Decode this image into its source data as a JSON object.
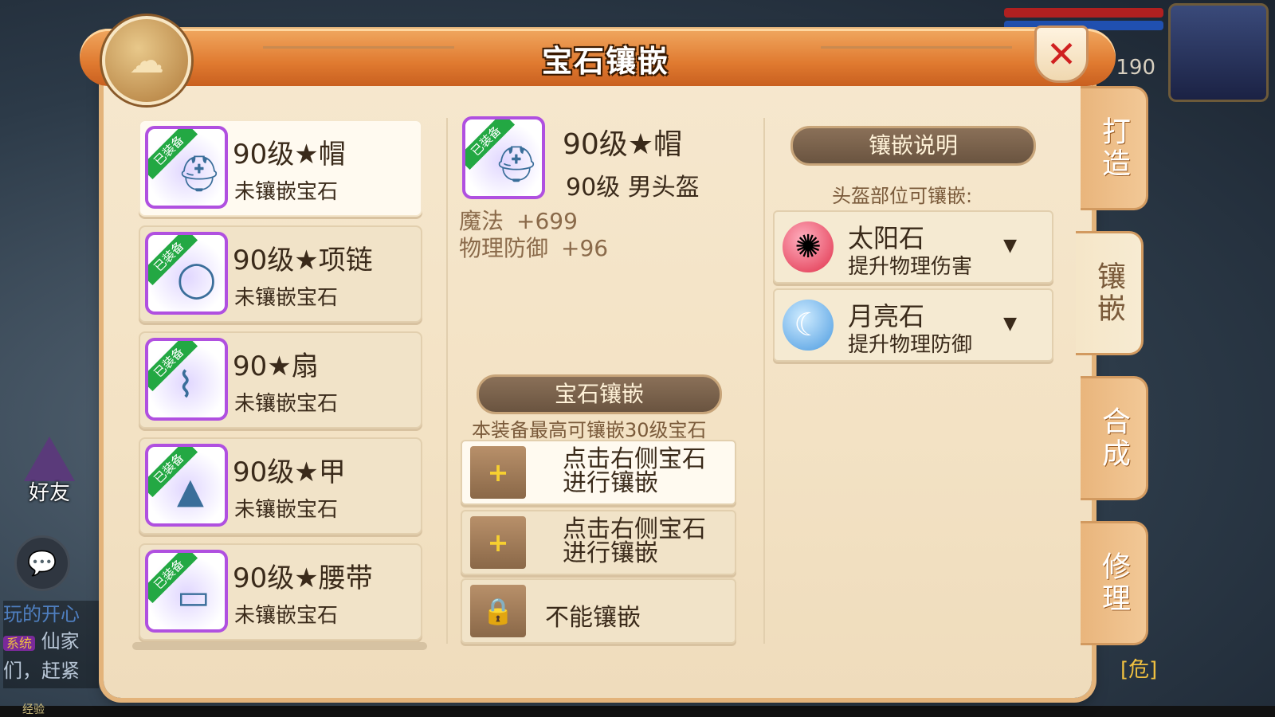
{
  "dialog": {
    "title": "宝石镶嵌",
    "close_icon": "✕"
  },
  "hud": {
    "level": "190"
  },
  "left_ui": {
    "friend_label": "好友",
    "chat_lines": [
      "玩的开心",
      "仙家",
      "们，赶紧"
    ],
    "chat_tag": "系统",
    "exp_label": "经验",
    "right_text": "[危]"
  },
  "side_tabs": [
    "打造",
    "镶嵌",
    "合成",
    "修理"
  ],
  "equipment": {
    "badge": "已装备",
    "items": [
      {
        "name": "90级★帽",
        "status": "未镶嵌宝石",
        "glyph": "⛑"
      },
      {
        "name": "90级★项链",
        "status": "未镶嵌宝石",
        "glyph": "◯"
      },
      {
        "name": "90★扇",
        "status": "未镶嵌宝石",
        "glyph": "⌇"
      },
      {
        "name": "90级★甲",
        "status": "未镶嵌宝石",
        "glyph": "▲"
      },
      {
        "name": "90级★腰带",
        "status": "未镶嵌宝石",
        "glyph": "▭"
      }
    ]
  },
  "selected": {
    "name": "90级★帽",
    "sub": "90级   男头盔",
    "attrs": [
      {
        "label": "魔法",
        "value": "+699"
      },
      {
        "label": "物理防御",
        "value": "+96"
      }
    ]
  },
  "gem_inlay": {
    "banner": "宝石镶嵌",
    "note": "本装备最高可镶嵌30级宝石",
    "slots": [
      {
        "line1": "点击右侧宝石",
        "line2": "进行镶嵌",
        "btn": "+"
      },
      {
        "line1": "点击右侧宝石",
        "line2": "进行镶嵌",
        "btn": "+"
      },
      {
        "text": "不能镶嵌"
      }
    ]
  },
  "inlay_info": {
    "banner": "镶嵌说明",
    "sub": "头盔部位可镶嵌:",
    "gems": [
      {
        "name": "太阳石",
        "desc": "提升物理伤害",
        "color": "#e0304a"
      },
      {
        "name": "月亮石",
        "desc": "提升物理防御",
        "color": "#4a9ae0"
      }
    ],
    "arrow": "▼"
  }
}
